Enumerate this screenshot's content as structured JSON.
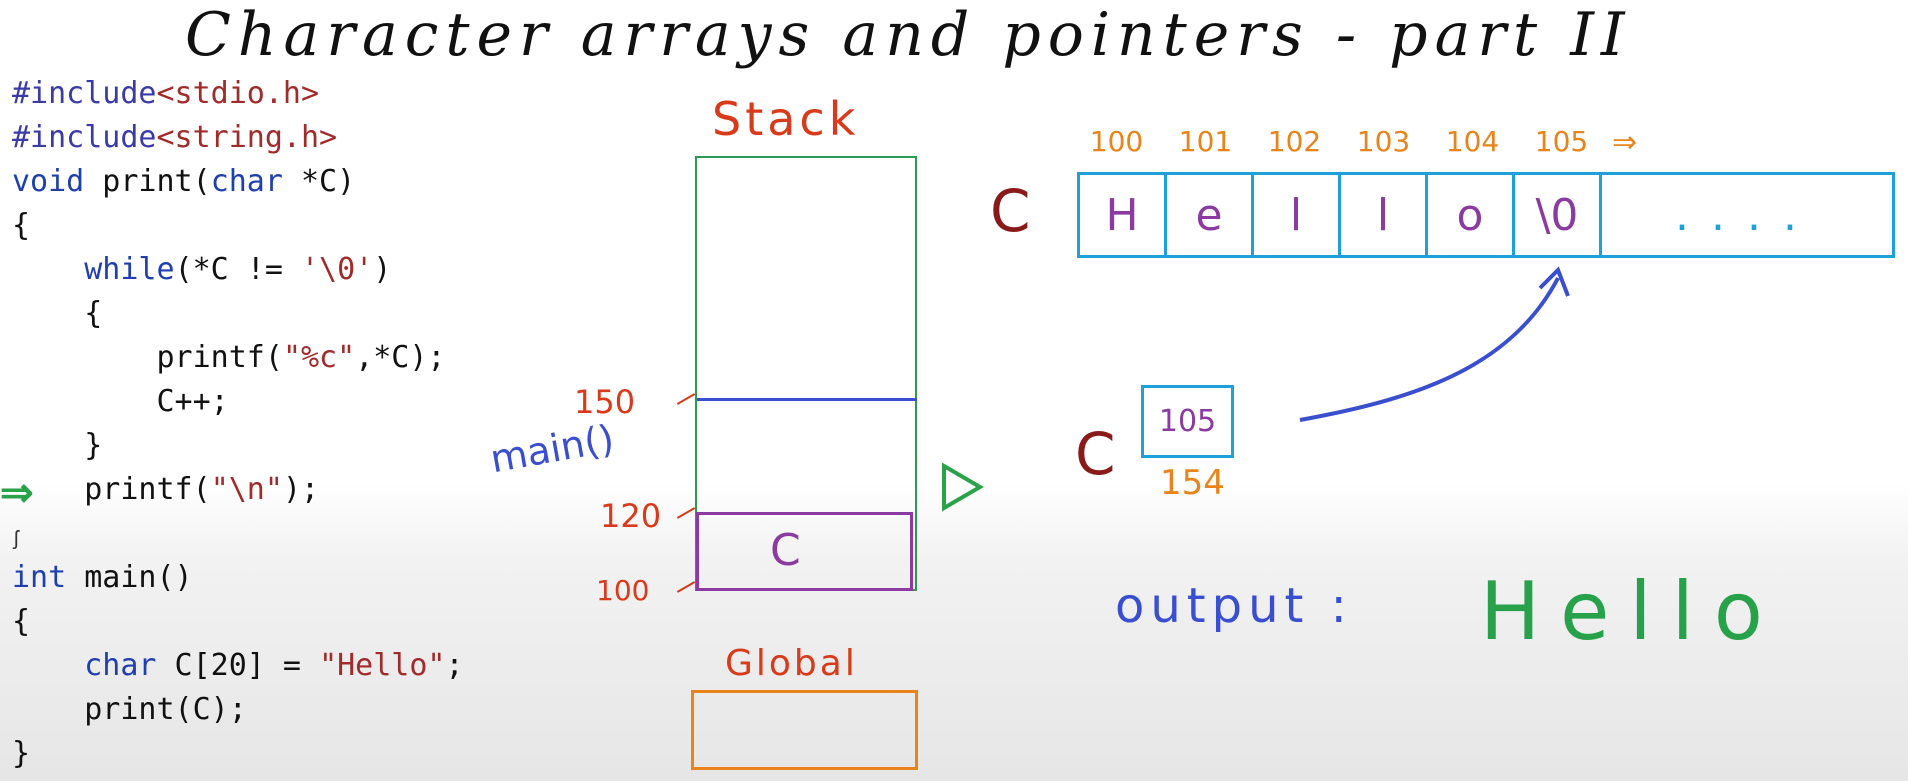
{
  "title": "Character arrays and pointers - part II",
  "code": {
    "lines": [
      {
        "parts": [
          {
            "t": "#include",
            "c": "inc"
          },
          {
            "t": "<stdio.h>",
            "c": "str"
          }
        ]
      },
      {
        "parts": [
          {
            "t": "#include",
            "c": "inc"
          },
          {
            "t": "<string.h>",
            "c": "str"
          }
        ]
      },
      {
        "parts": [
          {
            "t": "void",
            "c": "kw"
          },
          {
            "t": " print(",
            "c": ""
          },
          {
            "t": "char",
            "c": "kw"
          },
          {
            "t": " *C)",
            "c": ""
          }
        ]
      },
      {
        "parts": [
          {
            "t": "{",
            "c": ""
          }
        ]
      },
      {
        "parts": [
          {
            "t": "    ",
            "c": ""
          },
          {
            "t": "while",
            "c": "kw"
          },
          {
            "t": "(*C != ",
            "c": ""
          },
          {
            "t": "'\\0'",
            "c": "str"
          },
          {
            "t": ")",
            "c": ""
          }
        ]
      },
      {
        "parts": [
          {
            "t": "    {",
            "c": ""
          }
        ]
      },
      {
        "parts": [
          {
            "t": "        printf(",
            "c": ""
          },
          {
            "t": "\"%c\"",
            "c": "str"
          },
          {
            "t": ",*C);",
            "c": ""
          }
        ]
      },
      {
        "parts": [
          {
            "t": "        C++;",
            "c": ""
          }
        ]
      },
      {
        "parts": [
          {
            "t": "    }",
            "c": ""
          }
        ]
      },
      {
        "parts": [
          {
            "t": "    printf(",
            "c": ""
          },
          {
            "t": "\"\\n\"",
            "c": "str"
          },
          {
            "t": ");",
            "c": ""
          }
        ]
      },
      {
        "parts": [
          {
            "t": "",
            "c": ""
          }
        ]
      },
      {
        "parts": [
          {
            "t": "int",
            "c": "kw"
          },
          {
            "t": " main()",
            "c": ""
          }
        ]
      },
      {
        "parts": [
          {
            "t": "{",
            "c": ""
          }
        ]
      },
      {
        "parts": [
          {
            "t": "    ",
            "c": ""
          },
          {
            "t": "char",
            "c": "kw"
          },
          {
            "t": " C[20] = ",
            "c": ""
          },
          {
            "t": "\"Hello\"",
            "c": "str"
          },
          {
            "t": ";",
            "c": ""
          }
        ]
      },
      {
        "parts": [
          {
            "t": "    print(C);",
            "c": ""
          }
        ]
      },
      {
        "parts": [
          {
            "t": "}",
            "c": ""
          }
        ]
      }
    ],
    "current_line_marker": "⇒"
  },
  "stack": {
    "label": "Stack",
    "addr_150": "150",
    "addr_120": "120",
    "addr_100": "100",
    "frame_label": "main()",
    "frame_var": "C",
    "play_icon": "play-triangle-outline"
  },
  "global": {
    "label": "Global"
  },
  "array": {
    "name": "C",
    "addresses": [
      "100",
      "101",
      "102",
      "103",
      "104",
      "105"
    ],
    "addr_arrow": "⇒",
    "cells": [
      "H",
      "e",
      "l",
      "l",
      "o",
      "\\0"
    ],
    "rest": "...."
  },
  "pointer": {
    "name": "C",
    "value": "105",
    "address": "154"
  },
  "output": {
    "label": "output :",
    "value": "Hello"
  },
  "colors": {
    "stack_border": "#2a9a55",
    "frame_border": "#8a3aa0",
    "array_border": "#1ea1d8",
    "address_orange": "#e8841a",
    "address_red": "#d83a1a",
    "output_green": "#27a14a"
  }
}
